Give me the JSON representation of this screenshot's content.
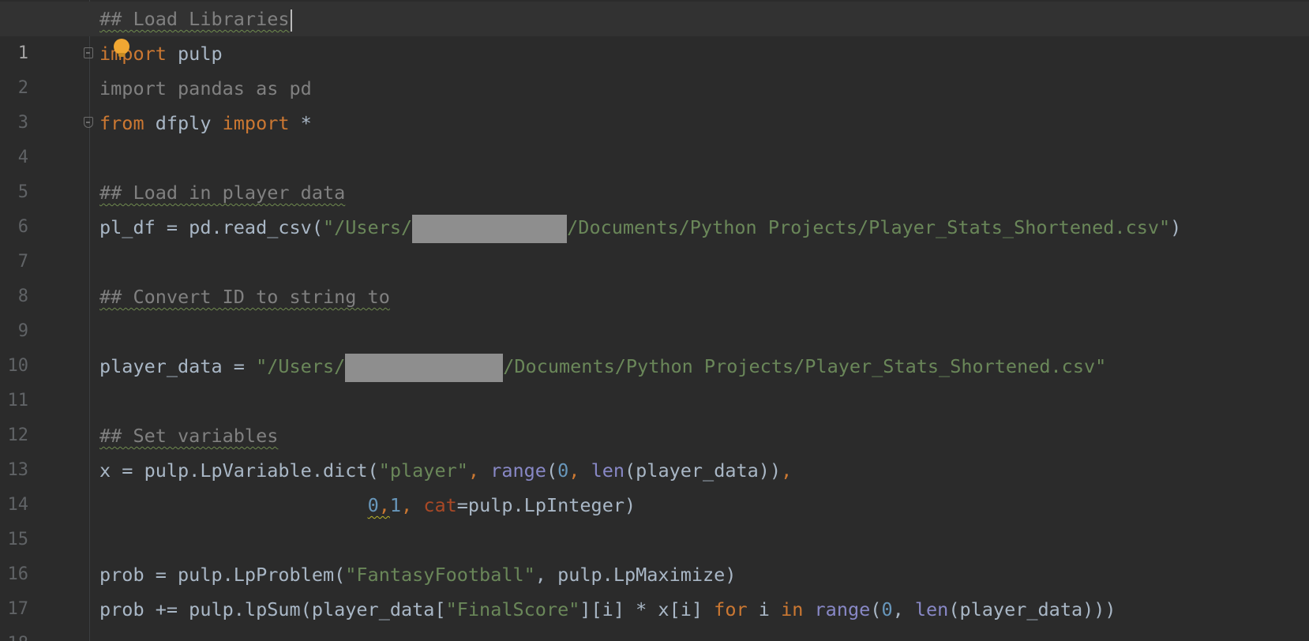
{
  "editor": {
    "language": "Python",
    "current_line": 1,
    "lines": [
      {
        "n": "1",
        "text": "## Load Libraries"
      },
      {
        "n": "2",
        "text": "import pulp"
      },
      {
        "n": "3",
        "text": "import pandas as pd"
      },
      {
        "n": "4",
        "text": "from dfply import *"
      },
      {
        "n": "5",
        "text": ""
      },
      {
        "n": "6",
        "text": "## Load in player data"
      },
      {
        "n": "7",
        "text": "pl_df = pd.read_csv(\"/Users/[redacted]/Documents/Python Projects/Player_Stats_Shortened.csv\")"
      },
      {
        "n": "8",
        "text": ""
      },
      {
        "n": "9",
        "text": "## Convert ID to string to"
      },
      {
        "n": "10",
        "text": ""
      },
      {
        "n": "11",
        "text": "player_data = \"/Users/[redacted]/Documents/Python Projects/Player_Stats_Shortened.csv\""
      },
      {
        "n": "12",
        "text": ""
      },
      {
        "n": "13",
        "text": "## Set variables"
      },
      {
        "n": "14",
        "text": "x = pulp.LpVariable.dict(\"player\", range(0, len(player_data)),"
      },
      {
        "n": "15",
        "text": "                        0,1, cat=pulp.LpInteger)"
      },
      {
        "n": "16",
        "text": ""
      },
      {
        "n": "17",
        "text": "prob = pulp.LpProblem(\"FantasyFootball\", pulp.LpMaximize)"
      },
      {
        "n": "18",
        "text": "prob += pulp.lpSum(player_data[\"FinalScore\"][i] * x[i] for i in range(0, len(player_data)))"
      }
    ],
    "tokens": {
      "c1": "## Load Libraries",
      "import": "import",
      "pulp": " pulp",
      "l3": "import pandas as pd",
      "from": "from",
      "dfply": " dfply ",
      "star": " *",
      "c6": "## Load in player data",
      "l7a": "pl_df = pd.read_csv(",
      "l7s1": "\"/Users/",
      "l7s2": "/Documents/Python Projects/Player_Stats_Shortened.csv\"",
      "l7z": ")",
      "c9": "## Convert ID to string to",
      "l11a": "player_data = ",
      "l11s1": "\"/Users/",
      "l11s2": "/Documents/Python Projects/Player_Stats_Shortened.csv\"",
      "c13": "## Set variables",
      "l14a": "x = pulp.LpVariable.dict(",
      "l14s": "\"player\"",
      "comma_sp": ", ",
      "range": "range",
      "lp": "(",
      "zero": "0",
      "len": "len",
      "l14b": "(player_data))",
      "comma": ",",
      "indent15": "                        ",
      "l15z": "0",
      "l15c": ",",
      "l15one": "1",
      "cat": "cat",
      "l15b": "=pulp.LpInteger)",
      "l17a": "prob = pulp.LpProblem(",
      "l17s": "\"FantasyFootball\"",
      "l17b": ", pulp.LpMaximize)",
      "l18a": "prob += pulp.lpSum(player_data[",
      "l18s": "\"FinalScore\"",
      "l18b": "][i] * x[i] ",
      "for": "for",
      "l18c": " i ",
      "in": "in",
      "l18d": "(player_data)))"
    }
  },
  "colors": {
    "background": "#2b2b2b",
    "keyword": "#cc7832",
    "string": "#6a8759",
    "number": "#6897bb",
    "builtin": "#8888c6",
    "param": "#aa4926",
    "comment": "#808080",
    "intention_bulb": "#f0a732"
  },
  "icons": [
    "intention-bulb-icon",
    "fold-marker-icon",
    "redaction-block"
  ]
}
